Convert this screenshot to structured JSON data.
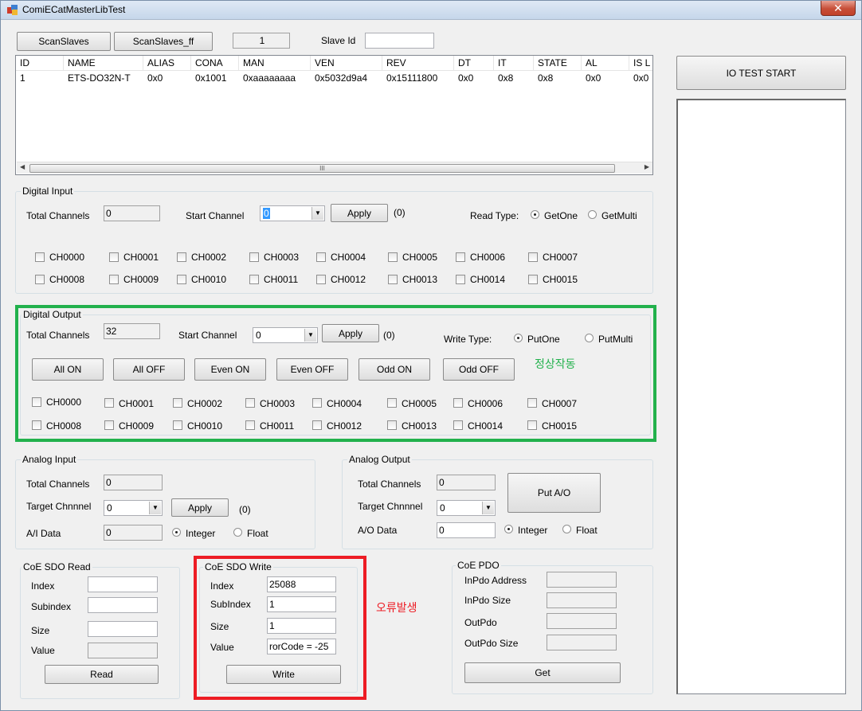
{
  "window": {
    "title": "ComiECatMasterLibTest",
    "close": "✕"
  },
  "top": {
    "scan_slaves": "ScanSlaves",
    "scan_slaves_ff": "ScanSlaves_ff",
    "count": "1",
    "slave_id_label": "Slave Id",
    "slave_id_value": ""
  },
  "slaves_table": {
    "columns": [
      "ID",
      "NAME",
      "ALIAS",
      "CONA",
      "MAN",
      "VEN",
      "REV",
      "DT",
      "IT",
      "STATE",
      "AL",
      "IS L"
    ],
    "rows": [
      [
        "1",
        "ETS-DO32N-T",
        "0x0",
        "0x1001",
        "0xaaaaaaaa",
        "0x5032d9a4",
        "0x15111800",
        "0x0",
        "0x8",
        "0x8",
        "0x0",
        "0x0"
      ]
    ],
    "scroll_grip": "III"
  },
  "io_test_button": "IO TEST START",
  "digital_input": {
    "legend": "Digital Input",
    "total_channels_label": "Total Channels",
    "total_channels_value": "0",
    "start_channel_label": "Start Channel",
    "start_channel_value": "0",
    "apply": "Apply",
    "result": "(0)",
    "read_type_label": "Read Type:",
    "get_one": "GetOne",
    "get_multi": "GetMulti",
    "channels": [
      "CH0000",
      "CH0001",
      "CH0002",
      "CH0003",
      "CH0004",
      "CH0005",
      "CH0006",
      "CH0007",
      "CH0008",
      "CH0009",
      "CH0010",
      "CH0011",
      "CH0012",
      "CH0013",
      "CH0014",
      "CH0015"
    ]
  },
  "digital_output": {
    "legend": "Digital Output",
    "total_channels_label": "Total Channels",
    "total_channels_value": "32",
    "start_channel_label": "Start Channel",
    "start_channel_value": "0",
    "apply": "Apply",
    "result": "(0)",
    "write_type_label": "Write Type:",
    "put_one": "PutOne",
    "put_multi": "PutMulti",
    "all_on": "All ON",
    "all_off": "All OFF",
    "even_on": "Even ON",
    "even_off": "Even OFF",
    "odd_on": "Odd ON",
    "odd_off": "Odd OFF",
    "note": "정상작동",
    "channels": [
      "CH0000",
      "CH0001",
      "CH0002",
      "CH0003",
      "CH0004",
      "CH0005",
      "CH0006",
      "CH0007",
      "CH0008",
      "CH0009",
      "CH0010",
      "CH0011",
      "CH0012",
      "CH0013",
      "CH0014",
      "CH0015"
    ]
  },
  "analog_input": {
    "legend": "Analog Input",
    "total_channels_label": "Total Channels",
    "total_channels_value": "0",
    "target_channel_label": "Target Chnnnel",
    "target_channel_value": "0",
    "apply": "Apply",
    "result": "(0)",
    "data_label": "A/I Data",
    "data_value": "0",
    "integer": "Integer",
    "float": "Float"
  },
  "analog_output": {
    "legend": "Analog Output",
    "total_channels_label": "Total Channels",
    "total_channels_value": "0",
    "target_channel_label": "Target Chnnnel",
    "target_channel_value": "0",
    "put_ao": "Put A/O",
    "data_label": "A/O Data",
    "data_value": "0",
    "integer": "Integer",
    "float": "Float"
  },
  "sdo_read": {
    "legend": "CoE SDO Read",
    "index_label": "Index",
    "subindex_label": "Subindex",
    "size_label": "Size",
    "value_label": "Value",
    "index_value": "",
    "subindex_value": "",
    "size_value": "",
    "value_value": "",
    "read": "Read"
  },
  "sdo_write": {
    "legend": "CoE SDO Write",
    "index_label": "Index",
    "subindex_label": "SubIndex",
    "size_label": "Size",
    "value_label": "Value",
    "index_value": "25088",
    "subindex_value": "1",
    "size_value": "1",
    "value_value": "rorCode = -25",
    "write": "Write",
    "note": "오류발생"
  },
  "pdo": {
    "legend": "CoE PDO",
    "inpdo_address_label": "InPdo Address",
    "inpdo_size_label": "InPdo Size",
    "outpdo_label": "OutPdo",
    "outpdo_size_label": "OutPdo Size",
    "get": "Get"
  },
  "colors": {
    "ok_highlight": "#22b14c",
    "error_highlight": "#ed1c24",
    "selection": "#3399ff"
  }
}
